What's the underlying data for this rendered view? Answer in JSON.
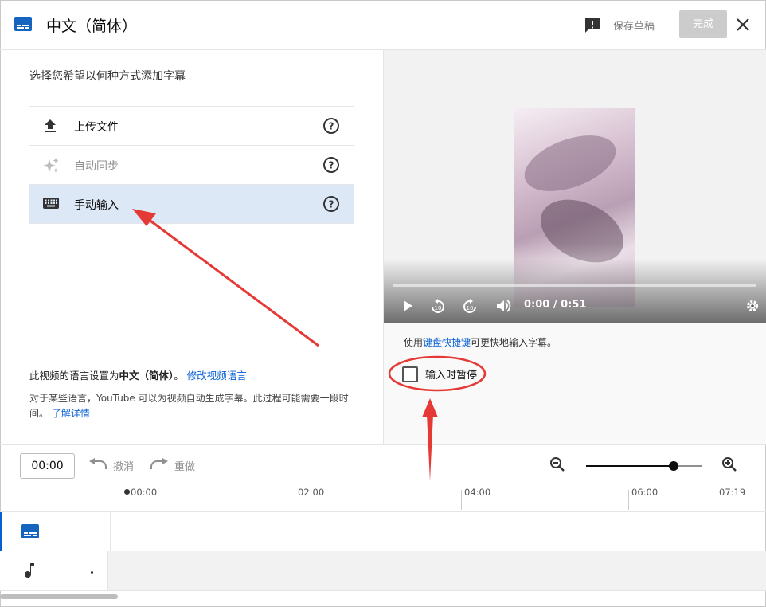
{
  "header": {
    "title": "中文（简体）",
    "save_draft": "保存草稿",
    "done": "完成"
  },
  "left": {
    "prompt": "选择您希望以何种方式添加字幕",
    "options": [
      {
        "label": "上传文件",
        "icon": "upload-icon",
        "state": "normal"
      },
      {
        "label": "自动同步",
        "icon": "sparkle-icon",
        "state": "disabled"
      },
      {
        "label": "手动输入",
        "icon": "keyboard-icon",
        "state": "selected"
      }
    ],
    "lang_prefix": "此视频的语言设置为",
    "lang_value": "中文（简体）",
    "lang_suffix": "。",
    "change_lang_link": "修改视频语言",
    "auto_note": "对于某些语言，YouTube 可以为视频自动生成字幕。此过程可能需要一段时间。",
    "learn_more_link": "了解详情"
  },
  "player": {
    "time": "0:00 / 0:51",
    "progress": 0
  },
  "right": {
    "hint_prefix": "使用",
    "hint_link": "键盘快捷键",
    "hint_suffix": "可更快地输入字幕。",
    "pause_label": "输入时暂停",
    "pause_checked": false
  },
  "timeline": {
    "current_time": "00:00",
    "undo": "撤消",
    "redo": "重做",
    "zoom_level": 0.75,
    "ticks": [
      "00:00",
      "02:00",
      "04:00",
      "06:00",
      "07:19"
    ]
  },
  "colors": {
    "accent": "#065fd4",
    "selected_bg": "#dde8f7",
    "annotation": "#e53935"
  }
}
